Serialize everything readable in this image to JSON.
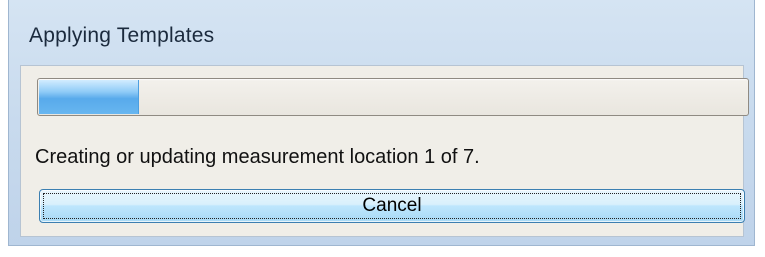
{
  "dialog": {
    "title": "Applying Templates",
    "progress": {
      "value_percent": 14,
      "fill_color": "#58aaeb"
    },
    "status_text": "Creating or updating measurement location 1 of 7.",
    "cancel_label": "Cancel"
  }
}
